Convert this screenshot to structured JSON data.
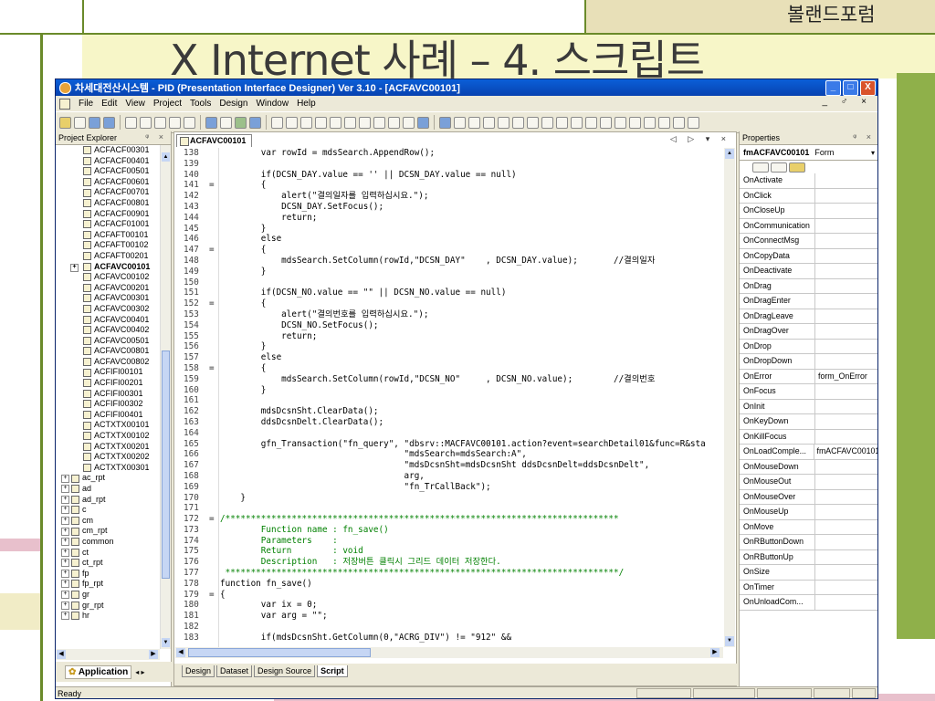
{
  "slide": {
    "title": "X Internet 사례 – 4. 스크립트",
    "corner_label": "볼랜드포럼"
  },
  "window": {
    "title": "차세대전산시스템 - PID (Presentation Interface Designer) Ver 3.10 - [ACFAVC00101]",
    "buttons": {
      "minimize": "_",
      "maximize": "□",
      "close": "X"
    }
  },
  "menu": [
    "File",
    "Edit",
    "View",
    "Project",
    "Tools",
    "Design",
    "Window",
    "Help"
  ],
  "mdi_controls": "_ ♂ ×",
  "explorer": {
    "header": "Project Explorer",
    "pin": "ᵠ ×",
    "items": [
      {
        "label": "ACFACF00301",
        "type": "file"
      },
      {
        "label": "ACFACF00401",
        "type": "file"
      },
      {
        "label": "ACFACF00501",
        "type": "file"
      },
      {
        "label": "ACFACF00601",
        "type": "file"
      },
      {
        "label": "ACFACF00701",
        "type": "file"
      },
      {
        "label": "ACFACF00801",
        "type": "file"
      },
      {
        "label": "ACFACF00901",
        "type": "file"
      },
      {
        "label": "ACFACF01001",
        "type": "file"
      },
      {
        "label": "ACFAFT00101",
        "type": "file"
      },
      {
        "label": "ACFAFT00102",
        "type": "file"
      },
      {
        "label": "ACFAFT00201",
        "type": "file"
      },
      {
        "label": "ACFAVC00101",
        "type": "file",
        "selected": true
      },
      {
        "label": "ACFAVC00102",
        "type": "file"
      },
      {
        "label": "ACFAVC00201",
        "type": "file"
      },
      {
        "label": "ACFAVC00301",
        "type": "file"
      },
      {
        "label": "ACFAVC00302",
        "type": "file"
      },
      {
        "label": "ACFAVC00401",
        "type": "file"
      },
      {
        "label": "ACFAVC00402",
        "type": "file"
      },
      {
        "label": "ACFAVC00501",
        "type": "file"
      },
      {
        "label": "ACFAVC00801",
        "type": "file"
      },
      {
        "label": "ACFAVC00802",
        "type": "file"
      },
      {
        "label": "ACFIFI00101",
        "type": "file"
      },
      {
        "label": "ACFIFI00201",
        "type": "file"
      },
      {
        "label": "ACFIFI00301",
        "type": "file"
      },
      {
        "label": "ACFIFI00302",
        "type": "file"
      },
      {
        "label": "ACFIFI00401",
        "type": "file"
      },
      {
        "label": "ACTXTX00101",
        "type": "file"
      },
      {
        "label": "ACTXTX00102",
        "type": "file"
      },
      {
        "label": "ACTXTX00201",
        "type": "file"
      },
      {
        "label": "ACTXTX00202",
        "type": "file"
      },
      {
        "label": "ACTXTX00301",
        "type": "file"
      },
      {
        "label": "ac_rpt",
        "type": "folder"
      },
      {
        "label": "ad",
        "type": "folder"
      },
      {
        "label": "ad_rpt",
        "type": "folder"
      },
      {
        "label": "c",
        "type": "folder"
      },
      {
        "label": "cm",
        "type": "folder"
      },
      {
        "label": "cm_rpt",
        "type": "folder"
      },
      {
        "label": "common",
        "type": "folder"
      },
      {
        "label": "ct",
        "type": "folder"
      },
      {
        "label": "ct_rpt",
        "type": "folder"
      },
      {
        "label": "fp",
        "type": "folder"
      },
      {
        "label": "fp_rpt",
        "type": "folder"
      },
      {
        "label": "gr",
        "type": "folder"
      },
      {
        "label": "gr_rpt",
        "type": "folder"
      },
      {
        "label": "hr",
        "type": "folder"
      }
    ],
    "bottom_tab": "Application"
  },
  "editor": {
    "tab": "ACFAVC00101",
    "controls": "◁ ▷ ▾ ×",
    "lines": [
      {
        "n": "138",
        "fold": "",
        "text": "        var rowId = mdsSearch.AppendRow();"
      },
      {
        "n": "139",
        "fold": "",
        "text": ""
      },
      {
        "n": "140",
        "fold": "",
        "text": "        if(DCSN_DAY.value == '' || DCSN_DAY.value == null)"
      },
      {
        "n": "141",
        "fold": "=",
        "text": "        {"
      },
      {
        "n": "142",
        "fold": "",
        "text": "            alert(\"결의일자를 입력하십시요.\");"
      },
      {
        "n": "143",
        "fold": "",
        "text": "            DCSN_DAY.SetFocus();"
      },
      {
        "n": "144",
        "fold": "",
        "text": "            return;"
      },
      {
        "n": "145",
        "fold": "",
        "text": "        }"
      },
      {
        "n": "146",
        "fold": "",
        "text": "        else"
      },
      {
        "n": "147",
        "fold": "=",
        "text": "        {"
      },
      {
        "n": "148",
        "fold": "",
        "text": "            mdsSearch.SetColumn(rowId,\"DCSN_DAY\"    , DCSN_DAY.value);       //결의일자"
      },
      {
        "n": "149",
        "fold": "",
        "text": "        }"
      },
      {
        "n": "150",
        "fold": "",
        "text": ""
      },
      {
        "n": "151",
        "fold": "",
        "text": "        if(DCSN_NO.value == \"\" || DCSN_NO.value == null)"
      },
      {
        "n": "152",
        "fold": "=",
        "text": "        {"
      },
      {
        "n": "153",
        "fold": "",
        "text": "            alert(\"결의번호를 입력하십시요.\");"
      },
      {
        "n": "154",
        "fold": "",
        "text": "            DCSN_NO.SetFocus();"
      },
      {
        "n": "155",
        "fold": "",
        "text": "            return;"
      },
      {
        "n": "156",
        "fold": "",
        "text": "        }"
      },
      {
        "n": "157",
        "fold": "",
        "text": "        else"
      },
      {
        "n": "158",
        "fold": "=",
        "text": "        {"
      },
      {
        "n": "159",
        "fold": "",
        "text": "            mdsSearch.SetColumn(rowId,\"DCSN_NO\"     , DCSN_NO.value);        //결의번호"
      },
      {
        "n": "160",
        "fold": "",
        "text": "        }"
      },
      {
        "n": "161",
        "fold": "",
        "text": ""
      },
      {
        "n": "162",
        "fold": "",
        "text": "        mdsDcsnSht.ClearData();"
      },
      {
        "n": "163",
        "fold": "",
        "text": "        ddsDcsnDelt.ClearData();"
      },
      {
        "n": "164",
        "fold": "",
        "text": ""
      },
      {
        "n": "165",
        "fold": "",
        "text": "        gfn_Transaction(\"fn_query\", \"dbsrv::MACFAVC00101.action?event=searchDetail01&func=R&sta"
      },
      {
        "n": "166",
        "fold": "",
        "text": "                                    \"mdsSearch=mdsSearch:A\","
      },
      {
        "n": "167",
        "fold": "",
        "text": "                                    \"mdsDcsnSht=mdsDcsnSht ddsDcsnDelt=ddsDcsnDelt\","
      },
      {
        "n": "168",
        "fold": "",
        "text": "                                    arg,"
      },
      {
        "n": "169",
        "fold": "",
        "text": "                                    \"fn_TrCallBack\");"
      },
      {
        "n": "170",
        "fold": "",
        "text": "    }"
      },
      {
        "n": "171",
        "fold": "",
        "text": ""
      },
      {
        "n": "172",
        "fold": "=",
        "text": "/*****************************************************************************"
      },
      {
        "n": "173",
        "fold": "",
        "text": "        Function name : fn_save()"
      },
      {
        "n": "174",
        "fold": "",
        "text": "        Parameters    :"
      },
      {
        "n": "175",
        "fold": "",
        "text": "        Return        : void"
      },
      {
        "n": "176",
        "fold": "",
        "text": "        Description   : 저장버튼 클릭시 그리드 데이터 저장한다."
      },
      {
        "n": "177",
        "fold": "",
        "text": " *****************************************************************************/"
      },
      {
        "n": "178",
        "fold": "",
        "text": "function fn_save()"
      },
      {
        "n": "179",
        "fold": "=",
        "text": "{"
      },
      {
        "n": "180",
        "fold": "",
        "text": "        var ix = 0;"
      },
      {
        "n": "181",
        "fold": "",
        "text": "        var arg = \"\";"
      },
      {
        "n": "182",
        "fold": "",
        "text": ""
      },
      {
        "n": "183",
        "fold": "",
        "text": "        if(mdsDcsnSht.GetColumn(0,\"ACRG_DIV\") != \"912\" &&"
      }
    ],
    "bottom_tabs": [
      "Design",
      "Dataset",
      "Design Source",
      "Script"
    ],
    "active_bottom_tab": "Script"
  },
  "properties": {
    "header": "Properties",
    "pin": "ᵠ ×",
    "object_name": "fmACFAVC00101",
    "object_type": "Form",
    "rows": [
      {
        "name": "OnActivate",
        "value": ""
      },
      {
        "name": "OnClick",
        "value": ""
      },
      {
        "name": "OnCloseUp",
        "value": ""
      },
      {
        "name": "OnCommunication",
        "value": ""
      },
      {
        "name": "OnConnectMsg",
        "value": ""
      },
      {
        "name": "OnCopyData",
        "value": ""
      },
      {
        "name": "OnDeactivate",
        "value": ""
      },
      {
        "name": "OnDrag",
        "value": ""
      },
      {
        "name": "OnDragEnter",
        "value": ""
      },
      {
        "name": "OnDragLeave",
        "value": ""
      },
      {
        "name": "OnDragOver",
        "value": ""
      },
      {
        "name": "OnDrop",
        "value": ""
      },
      {
        "name": "OnDropDown",
        "value": ""
      },
      {
        "name": "OnError",
        "value": "form_OnError"
      },
      {
        "name": "OnFocus",
        "value": ""
      },
      {
        "name": "OnInit",
        "value": ""
      },
      {
        "name": "OnKeyDown",
        "value": ""
      },
      {
        "name": "OnKillFocus",
        "value": ""
      },
      {
        "name": "OnLoadComple...",
        "value": "fmACFAVC00101"
      },
      {
        "name": "OnMouseDown",
        "value": ""
      },
      {
        "name": "OnMouseOut",
        "value": ""
      },
      {
        "name": "OnMouseOver",
        "value": ""
      },
      {
        "name": "OnMouseUp",
        "value": ""
      },
      {
        "name": "OnMove",
        "value": ""
      },
      {
        "name": "OnRButtonDown",
        "value": ""
      },
      {
        "name": "OnRButtonUp",
        "value": ""
      },
      {
        "name": "OnSize",
        "value": ""
      },
      {
        "name": "OnTimer",
        "value": ""
      },
      {
        "name": "OnUnloadCom...",
        "value": ""
      }
    ]
  },
  "status": {
    "text": "Ready"
  },
  "colors": {
    "accent_title_bar": "#0842b0",
    "slide_green": "#8fb04a",
    "slide_pink": "#e8c0cc",
    "slide_tan": "#e8e0b8"
  }
}
